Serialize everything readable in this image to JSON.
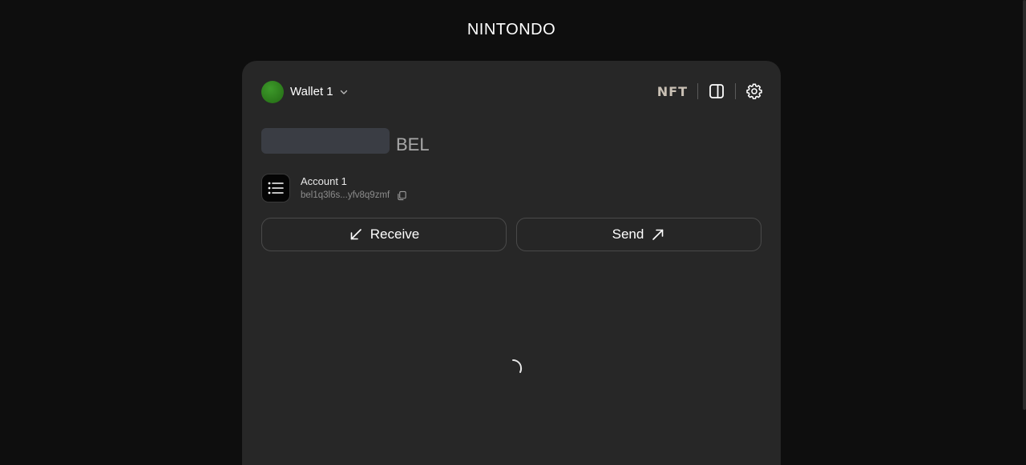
{
  "header": {
    "brand": "NINTONDO"
  },
  "wallet": {
    "name": "Wallet 1",
    "avatar_color": "#2f8a1e"
  },
  "toolbar": {
    "nft_label": "NFT",
    "layout_icon": "sidebar-layout-icon",
    "settings_icon": "gear-icon"
  },
  "balance": {
    "unit": "BEL",
    "loading": true
  },
  "account": {
    "name": "Account 1",
    "address": "bel1q3l6s...yfv8q9zmf"
  },
  "actions": {
    "receive_label": "Receive",
    "send_label": "Send"
  },
  "content": {
    "loading": true
  }
}
